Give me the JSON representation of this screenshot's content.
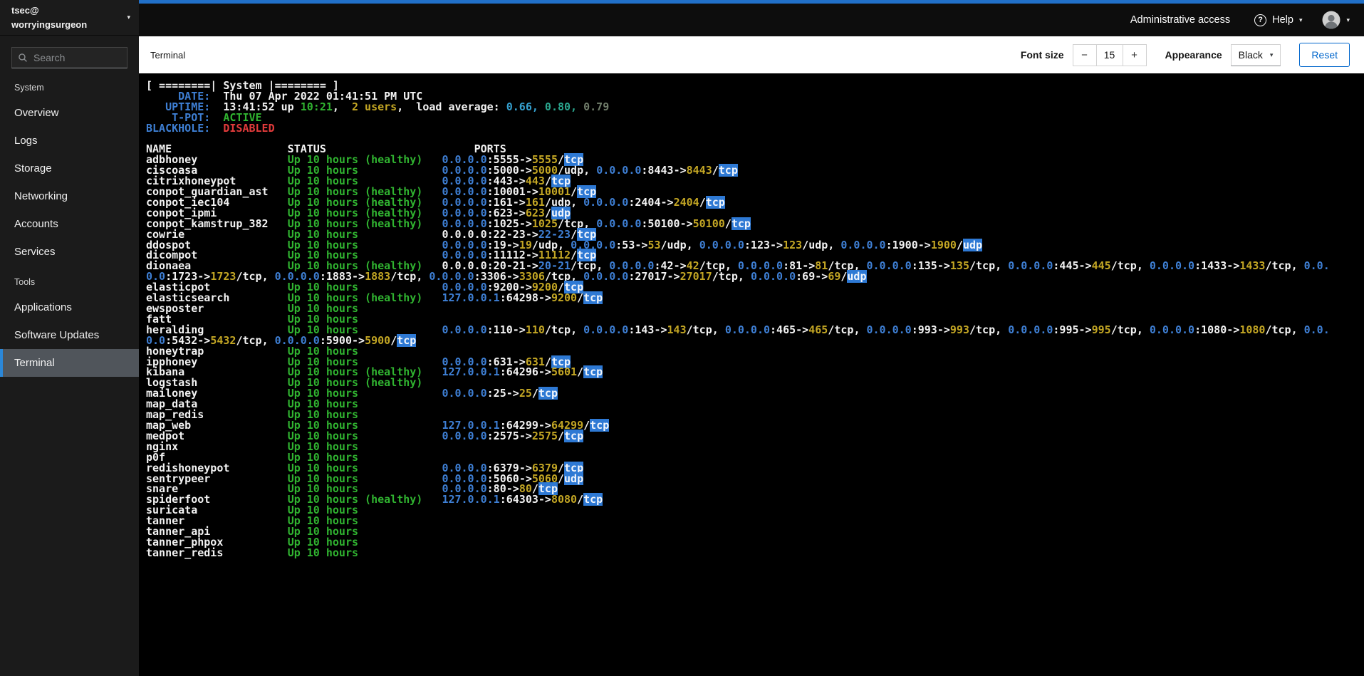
{
  "colors": {
    "accent": "#2170c8",
    "masthead_bg": "#0d0d0d",
    "sidebar_bg": "#1b1b1b",
    "nav_active_bg": "#50555b",
    "nav_active_bar": "#2b87d8",
    "toolbar_bg": "#ffffff",
    "terminal_bg": "#000000",
    "link_blue": "#0066cc"
  },
  "icons": {
    "chevron_down": "▾",
    "help_glyph": "?"
  },
  "topbar": {
    "admin_access_label": "Administrative access",
    "help_label": "Help"
  },
  "sidebar": {
    "user": "tsec@",
    "host": "worryingsurgeon",
    "search_placeholder": "Search",
    "sections": [
      {
        "title": "System",
        "items": [
          {
            "label": "Overview"
          },
          {
            "label": "Logs"
          },
          {
            "label": "Storage"
          },
          {
            "label": "Networking"
          },
          {
            "label": "Accounts"
          },
          {
            "label": "Services"
          }
        ]
      },
      {
        "title": "Tools",
        "items": [
          {
            "label": "Applications"
          },
          {
            "label": "Software Updates"
          },
          {
            "label": "Terminal",
            "active": true
          }
        ]
      }
    ]
  },
  "toolbar": {
    "page_title": "Terminal",
    "font_size_label": "Font size",
    "font_size_decrease_glyph": "−",
    "font_size_value": "15",
    "font_size_increase_glyph": "+",
    "appearance_label": "Appearance",
    "theme_value": "Black",
    "reset_label": "Reset"
  },
  "terminal": {
    "palette": {
      "fg": "#f2f2f2",
      "blue": "#3e7fd4",
      "green": "#30b330",
      "yellow": "#c3a624",
      "cyan": "#35a0cf",
      "teal": "#2aa58d",
      "dim": "#707d6a",
      "red": "#e23b3b",
      "chip_bg": "#2e79d4",
      "chip_fg": "#f2f6fc"
    },
    "banner": "[ ========| System |======== ]",
    "info_rows": [
      {
        "label": "DATE:",
        "segments": [
          [
            "Thu 07 Apr 2022 01:41:51 PM UTC",
            "fg"
          ]
        ]
      },
      {
        "label": "UPTIME:",
        "segments": [
          [
            "13:41:52 up ",
            "fg"
          ],
          [
            "10:21",
            "green"
          ],
          [
            ",  ",
            "fg"
          ],
          [
            "2 users",
            "yellow"
          ],
          [
            ",  load average: ",
            "fg"
          ],
          [
            "0.66,",
            "cyan"
          ],
          [
            " 0.80,",
            "teal"
          ],
          [
            " 0.79",
            "dim"
          ]
        ]
      },
      {
        "label": "T-POT:",
        "segments": [
          [
            "ACTIVE",
            "green"
          ]
        ]
      },
      {
        "label": "BLACKHOLE:",
        "segments": [
          [
            "DISABLED",
            "red"
          ]
        ]
      }
    ],
    "columns": {
      "name": "NAME",
      "status": "STATUS",
      "ports": "PORTS"
    },
    "rows": [
      {
        "name": "adbhoney",
        "status": "Up 10 hours (healthy)",
        "ports": [
          {
            "ip": "0.0.0.0",
            "pub": "5555",
            "dst": "5555",
            "proto": "tcp"
          }
        ]
      },
      {
        "name": "ciscoasa",
        "status": "Up 10 hours",
        "ports": [
          {
            "ip": "0.0.0.0",
            "pub": "5000",
            "dst": "5000",
            "proto": "udp"
          },
          {
            "ip": "0.0.0.0",
            "pub": "8443",
            "dst": "8443",
            "proto": "tcp"
          }
        ]
      },
      {
        "name": "citrixhoneypot",
        "status": "Up 10 hours",
        "ports": [
          {
            "ip": "0.0.0.0",
            "pub": "443",
            "dst": "443",
            "proto": "tcp"
          }
        ]
      },
      {
        "name": "conpot_guardian_ast",
        "status": "Up 10 hours (healthy)",
        "ports": [
          {
            "ip": "0.0.0.0",
            "pub": "10001",
            "dst": "10001",
            "proto": "tcp"
          }
        ]
      },
      {
        "name": "conpot_iec104",
        "status": "Up 10 hours (healthy)",
        "ports": [
          {
            "ip": "0.0.0.0",
            "pub": "161",
            "dst": "161",
            "proto": "udp"
          },
          {
            "ip": "0.0.0.0",
            "pub": "2404",
            "dst": "2404",
            "proto": "tcp"
          }
        ]
      },
      {
        "name": "conpot_ipmi",
        "status": "Up 10 hours (healthy)",
        "ports": [
          {
            "ip": "0.0.0.0",
            "pub": "623",
            "dst": "623",
            "proto": "udp"
          }
        ]
      },
      {
        "name": "conpot_kamstrup_382",
        "status": "Up 10 hours (healthy)",
        "ports": [
          {
            "ip": "0.0.0.0",
            "pub": "1025",
            "dst": "1025",
            "proto": "tcp"
          },
          {
            "ip": "0.0.0.0",
            "pub": "50100",
            "dst": "50100",
            "proto": "tcp"
          }
        ]
      },
      {
        "name": "cowrie",
        "status": "Up 10 hours",
        "ports": [
          {
            "ip": "0.0.0.0",
            "pub": "22-23",
            "dst": "22-23",
            "proto": "tcp"
          }
        ]
      },
      {
        "name": "ddospot",
        "status": "Up 10 hours",
        "ports": [
          {
            "ip": "0.0.0.0",
            "pub": "19",
            "dst": "19",
            "proto": "udp"
          },
          {
            "ip": "0.0.0.0",
            "pub": "53",
            "dst": "53",
            "proto": "udp"
          },
          {
            "ip": "0.0.0.0",
            "pub": "123",
            "dst": "123",
            "proto": "udp"
          },
          {
            "ip": "0.0.0.0",
            "pub": "1900",
            "dst": "1900",
            "proto": "udp"
          }
        ]
      },
      {
        "name": "dicompot",
        "status": "Up 10 hours",
        "ports": [
          {
            "ip": "0.0.0.0",
            "pub": "11112",
            "dst": "11112",
            "proto": "tcp"
          }
        ]
      },
      {
        "name": "dionaea",
        "status": "Up 10 hours (healthy)",
        "ports": [
          {
            "ip": "0.0.0.0",
            "pub": "20-21",
            "dst": "20-21",
            "proto": "tcp"
          },
          {
            "ip": "0.0.0.0",
            "pub": "42",
            "dst": "42",
            "proto": "tcp"
          },
          {
            "ip": "0.0.0.0",
            "pub": "81",
            "dst": "81",
            "proto": "tcp"
          },
          {
            "ip": "0.0.0.0",
            "pub": "135",
            "dst": "135",
            "proto": "tcp"
          },
          {
            "ip": "0.0.0.0",
            "pub": "445",
            "dst": "445",
            "proto": "tcp"
          },
          {
            "ip": "0.0.0.0",
            "pub": "1433",
            "dst": "1433",
            "proto": "tcp"
          },
          {
            "ip": "0.0.0.0",
            "pub": "1723",
            "dst": "1723",
            "proto": "tcp"
          },
          {
            "ip": "0.0.0.0",
            "pub": "1883",
            "dst": "1883",
            "proto": "tcp"
          },
          {
            "ip": "0.0.0.0",
            "pub": "3306",
            "dst": "3306",
            "proto": "tcp"
          },
          {
            "ip": "0.0.0.0",
            "pub": "27017",
            "dst": "27017",
            "proto": "tcp"
          },
          {
            "ip": "0.0.0.0",
            "pub": "69",
            "dst": "69",
            "proto": "udp"
          }
        ]
      },
      {
        "name": "elasticpot",
        "status": "Up 10 hours",
        "ports": [
          {
            "ip": "0.0.0.0",
            "pub": "9200",
            "dst": "9200",
            "proto": "tcp"
          }
        ]
      },
      {
        "name": "elasticsearch",
        "status": "Up 10 hours (healthy)",
        "ports": [
          {
            "ip": "127.0.0.1",
            "pub": "64298",
            "dst": "9200",
            "proto": "tcp"
          }
        ]
      },
      {
        "name": "ewsposter",
        "status": "Up 10 hours",
        "ports": []
      },
      {
        "name": "fatt",
        "status": "Up 10 hours",
        "ports": []
      },
      {
        "name": "heralding",
        "status": "Up 10 hours",
        "ports": [
          {
            "ip": "0.0.0.0",
            "pub": "110",
            "dst": "110",
            "proto": "tcp"
          },
          {
            "ip": "0.0.0.0",
            "pub": "143",
            "dst": "143",
            "proto": "tcp"
          },
          {
            "ip": "0.0.0.0",
            "pub": "465",
            "dst": "465",
            "proto": "tcp"
          },
          {
            "ip": "0.0.0.0",
            "pub": "993",
            "dst": "993",
            "proto": "tcp"
          },
          {
            "ip": "0.0.0.0",
            "pub": "995",
            "dst": "995",
            "proto": "tcp"
          },
          {
            "ip": "0.0.0.0",
            "pub": "1080",
            "dst": "1080",
            "proto": "tcp"
          },
          {
            "ip": "0.0.0.0",
            "pub": "5432",
            "dst": "5432",
            "proto": "tcp"
          },
          {
            "ip": "0.0.0.0",
            "pub": "5900",
            "dst": "5900",
            "proto": "tcp"
          }
        ]
      },
      {
        "name": "honeytrap",
        "status": "Up 10 hours",
        "ports": []
      },
      {
        "name": "ipphoney",
        "status": "Up 10 hours",
        "ports": [
          {
            "ip": "0.0.0.0",
            "pub": "631",
            "dst": "631",
            "proto": "tcp"
          }
        ]
      },
      {
        "name": "kibana",
        "status": "Up 10 hours (healthy)",
        "ports": [
          {
            "ip": "127.0.0.1",
            "pub": "64296",
            "dst": "5601",
            "proto": "tcp"
          }
        ]
      },
      {
        "name": "logstash",
        "status": "Up 10 hours (healthy)",
        "ports": []
      },
      {
        "name": "mailoney",
        "status": "Up 10 hours",
        "ports": [
          {
            "ip": "0.0.0.0",
            "pub": "25",
            "dst": "25",
            "proto": "tcp"
          }
        ]
      },
      {
        "name": "map_data",
        "status": "Up 10 hours",
        "ports": []
      },
      {
        "name": "map_redis",
        "status": "Up 10 hours",
        "ports": []
      },
      {
        "name": "map_web",
        "status": "Up 10 hours",
        "ports": [
          {
            "ip": "127.0.0.1",
            "pub": "64299",
            "dst": "64299",
            "proto": "tcp"
          }
        ]
      },
      {
        "name": "medpot",
        "status": "Up 10 hours",
        "ports": [
          {
            "ip": "0.0.0.0",
            "pub": "2575",
            "dst": "2575",
            "proto": "tcp"
          }
        ]
      },
      {
        "name": "nginx",
        "status": "Up 10 hours",
        "ports": []
      },
      {
        "name": "p0f",
        "status": "Up 10 hours",
        "ports": []
      },
      {
        "name": "redishoneypot",
        "status": "Up 10 hours",
        "ports": [
          {
            "ip": "0.0.0.0",
            "pub": "6379",
            "dst": "6379",
            "proto": "tcp"
          }
        ]
      },
      {
        "name": "sentrypeer",
        "status": "Up 10 hours",
        "ports": [
          {
            "ip": "0.0.0.0",
            "pub": "5060",
            "dst": "5060",
            "proto": "udp"
          }
        ]
      },
      {
        "name": "snare",
        "status": "Up 10 hours",
        "ports": [
          {
            "ip": "0.0.0.0",
            "pub": "80",
            "dst": "80",
            "proto": "tcp"
          }
        ]
      },
      {
        "name": "spiderfoot",
        "status": "Up 10 hours (healthy)",
        "ports": [
          {
            "ip": "127.0.0.1",
            "pub": "64303",
            "dst": "8080",
            "proto": "tcp"
          }
        ]
      },
      {
        "name": "suricata",
        "status": "Up 10 hours",
        "ports": []
      },
      {
        "name": "tanner",
        "status": "Up 10 hours",
        "ports": []
      },
      {
        "name": "tanner_api",
        "status": "Up 10 hours",
        "ports": []
      },
      {
        "name": "tanner_phpox",
        "status": "Up 10 hours",
        "ports": []
      },
      {
        "name": "tanner_redis",
        "status": "Up 10 hours",
        "ports": []
      }
    ]
  }
}
